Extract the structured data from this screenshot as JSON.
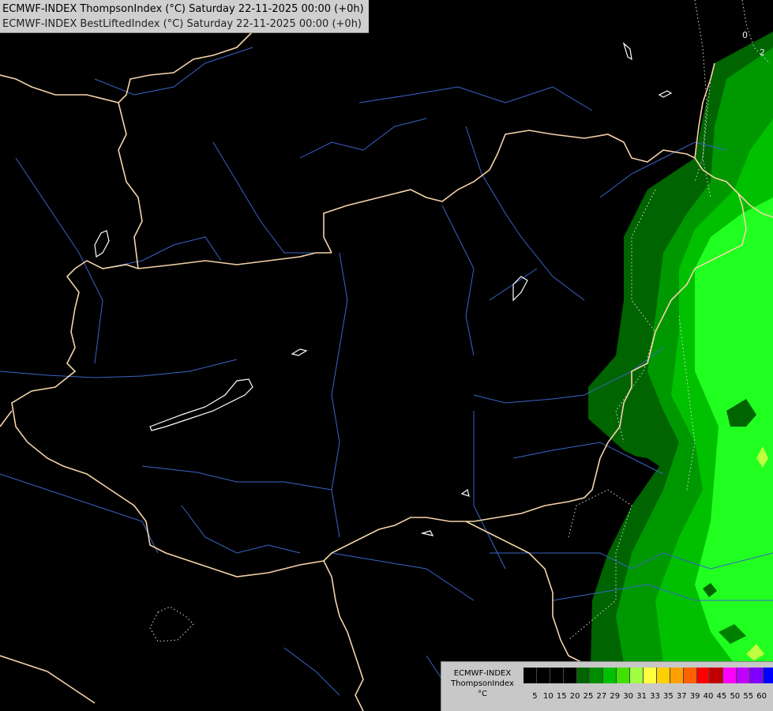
{
  "title": {
    "line1": "ECMWF-INDEX ThompsonIndex (°C) Saturday 22-11-2025 00:00 (+0h)",
    "line2": "ECMWF-INDEX BestLiftedIndex (°C) Saturday 22-11-2025 00:00 (+0h)"
  },
  "legend": {
    "line1": "ECMWF-INDEX",
    "line2": "ThompsonIndex",
    "unit": "°C",
    "ticks": [
      "5",
      "10",
      "15",
      "20",
      "25",
      "27",
      "29",
      "30",
      "31",
      "33",
      "35",
      "37",
      "39",
      "40",
      "45",
      "50",
      "55",
      "60"
    ],
    "colors": [
      "#000000",
      "#000000",
      "#000000",
      "#000000",
      "#006400",
      "#008c00",
      "#00c000",
      "#40e000",
      "#a0ff40",
      "#ffff40",
      "#ffd000",
      "#ffa000",
      "#ff6000",
      "#ff0000",
      "#c00000",
      "#ff00ff",
      "#c000ff",
      "#8000ff",
      "#0000ff"
    ]
  },
  "map": {
    "contour_labels": [
      "2",
      "0"
    ],
    "fill_colors": {
      "dark": "#006400",
      "mid": "#00b000",
      "bright": "#20ff20",
      "light": "#c0ff40"
    },
    "border_color": "#f5d3a8",
    "river_color": "#3a64c8",
    "lake_color": "#ffffff"
  }
}
